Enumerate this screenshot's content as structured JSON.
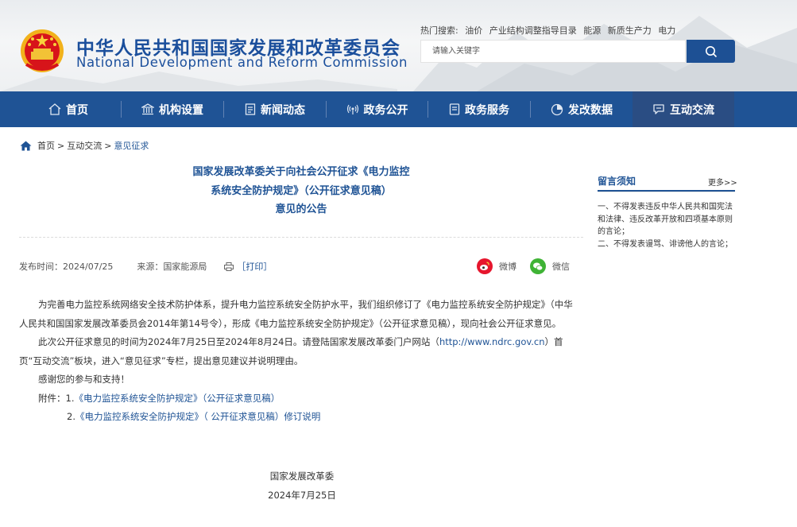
{
  "header": {
    "logo_cn": "中华人民共和国国家发展和改革委员会",
    "logo_en": "National Development and Reform Commission",
    "hot_label": "热门搜索:",
    "hot_items": [
      "油价",
      "产业结构调整指导目录",
      "能源",
      "新质生产力",
      "电力"
    ],
    "search_placeholder": "请输入关键字"
  },
  "nav": [
    {
      "label": "首页",
      "icon": "home-icon"
    },
    {
      "label": "机构设置",
      "icon": "institution-icon"
    },
    {
      "label": "新闻动态",
      "icon": "news-icon"
    },
    {
      "label": "政务公开",
      "icon": "broadcast-icon"
    },
    {
      "label": "政务服务",
      "icon": "service-icon"
    },
    {
      "label": "发改数据",
      "icon": "pie-chart-icon"
    },
    {
      "label": "互动交流",
      "icon": "chat-icon",
      "active": true
    }
  ],
  "breadcrumb": {
    "home": "首页",
    "sep": ">",
    "level1": "互动交流",
    "current": "意见征求"
  },
  "article": {
    "title_line1": "国家发展改革委关于向社会公开征求《电力监控",
    "title_line2": "系统安全防护规定》（公开征求意见稿）",
    "title_line3": "意见的公告",
    "publish_label": "发布时间：",
    "publish_date": "2024/07/25",
    "source_label": "来源：",
    "source": "国家能源局",
    "print": "［打印］",
    "share_weibo": "微博",
    "share_wechat": "微信",
    "para1": "为完善电力监控系统网络安全技术防护体系，提升电力监控系统安全防护水平，我们组织修订了《电力监控系统安全防护规定》（中华人民共和国国家发展改革委员会2014年第14号令），形成《电力监控系统安全防护规定》（公开征求意见稿），现向社会公开征求意见。",
    "para2_a": "此次公开征求意见的时间为2024年7月25日至2024年8月24日。请登陆国家发展改革委门户网站（",
    "para2_link": "http://www.ndrc.gov.cn",
    "para2_b": "）首页“互动交流”板块，进入“意见征求”专栏，提出意见建议并说明理由。",
    "para3": "感谢您的参与和支持！",
    "attach_label": "附件：1.",
    "attach1": "《电力监控系统安全防护规定》（公开征求意见稿）",
    "attach2_num": "2.",
    "attach2": "《电力监控系统安全防护规定》（ 公开征求意见稿）修订说明",
    "sign_org": "国家发展改革委",
    "sign_date": "2024年7月25日"
  },
  "sidebar": {
    "title": "留言须知",
    "more": "更多>>",
    "rule1": "一、不得发表违反中华人民共和国宪法和法律、违反改革开放和四项基本原则的言论；",
    "rule2": "二、不得发表谩骂、诽谤他人的言论；"
  },
  "colors": {
    "nav_bg": "#1f5395",
    "nav_active": "#2a4d83",
    "link": "#1f5395",
    "weibo": "#e6162d",
    "wechat": "#3fb335"
  }
}
